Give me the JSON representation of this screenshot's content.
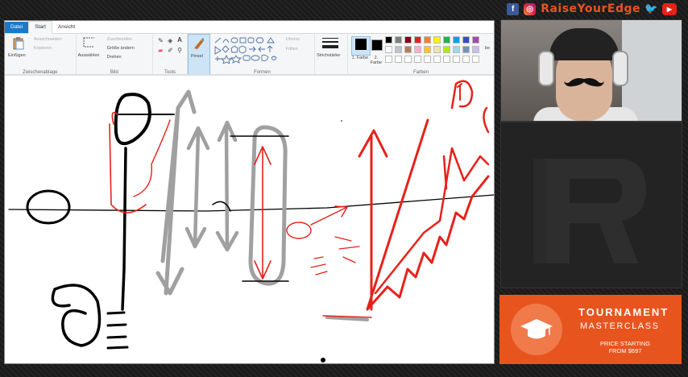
{
  "brand": {
    "name": "RaiseYourEdge"
  },
  "social_icons": [
    {
      "name": "facebook-icon",
      "glyph": "f"
    },
    {
      "name": "instagram-icon",
      "glyph": "◎"
    },
    {
      "name": "twitter-icon",
      "glyph": "🐦"
    },
    {
      "name": "youtube-icon",
      "glyph": "▶"
    }
  ],
  "paint": {
    "tabs": [
      "Datei",
      "Start",
      "Ansicht"
    ],
    "groups": {
      "clipboard": {
        "label": "Zwischenablage",
        "paste": "Einfügen",
        "cut": "Ausschneiden",
        "copy": "Kopieren"
      },
      "image": {
        "label": "Bild",
        "select": "Auswählen",
        "crop": "Zuschneiden",
        "resize": "Größe ändern",
        "rotate": "Drehen"
      },
      "tools": {
        "label": "Tools"
      },
      "brushes": {
        "label": "Pinsel"
      },
      "shapes": {
        "label": "Formen",
        "outline": "Umriss",
        "fill": "Füllen"
      },
      "size": {
        "label": "Strichstärke"
      },
      "colors": {
        "label": "Farben",
        "color1": "1. Farbe",
        "color2": "2. Farbe",
        "edit": "be"
      }
    },
    "palette_row1": [
      "#000000",
      "#7f7f7f",
      "#880015",
      "#ed1c24",
      "#ff7f27",
      "#fff200",
      "#22b14c",
      "#00a2e8",
      "#3f48cc",
      "#a349a4"
    ],
    "palette_row2": [
      "#ffffff",
      "#c3c3c3",
      "#b97a57",
      "#ffaec9",
      "#ffc90e",
      "#efe4b0",
      "#b5e61d",
      "#99d9ea",
      "#7092be",
      "#c8bfe7"
    ],
    "canvas": {
      "colors": {
        "black": "#000000",
        "gray": "#a0a0a0",
        "red": "#e8201a"
      }
    }
  },
  "ad": {
    "title": "TOURNAMENT",
    "subtitle": "MASTERCLASS",
    "price_line1": "PRICE STARTING",
    "price_line2": "FROM $697",
    "color": "#e8541e"
  }
}
